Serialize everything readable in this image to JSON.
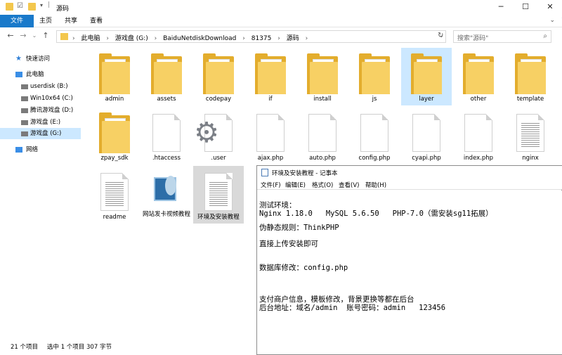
{
  "explorer": {
    "title": "源码",
    "ribbon_tabs": [
      "文件",
      "主页",
      "共享",
      "查看"
    ],
    "breadcrumb": [
      "此电脑",
      "游戏盘 (G:)",
      "BaiduNetdiskDownload",
      "81375",
      "源码"
    ],
    "search_placeholder": "搜索\"源码\"",
    "nav": {
      "quick_access": "快速访问",
      "this_pc": "此电脑",
      "drives": [
        "userdisk (B:)",
        "Win10x64 (C:)",
        "腾讯游戏盘 (D:)",
        "游戏盘 (E:)",
        "游戏盘 (G:)"
      ],
      "network": "网络"
    },
    "items": [
      {
        "name": "admin",
        "type": "folder"
      },
      {
        "name": "assets",
        "type": "folder"
      },
      {
        "name": "codepay",
        "type": "folder"
      },
      {
        "name": "if",
        "type": "folder"
      },
      {
        "name": "install",
        "type": "folder"
      },
      {
        "name": "js",
        "type": "folder"
      },
      {
        "name": "layer",
        "type": "folder"
      },
      {
        "name": "other",
        "type": "folder"
      },
      {
        "name": "template",
        "type": "folder"
      },
      {
        "name": "zpay_sdk",
        "type": "folder"
      },
      {
        "name": ".htaccess",
        "type": "file"
      },
      {
        "name": ".user",
        "type": "settings"
      },
      {
        "name": "ajax.php",
        "type": "file"
      },
      {
        "name": "auto.php",
        "type": "file"
      },
      {
        "name": "config.php",
        "type": "file"
      },
      {
        "name": "cyapi.php",
        "type": "file"
      },
      {
        "name": "index.php",
        "type": "file"
      },
      {
        "name": "nginx",
        "type": "text"
      },
      {
        "name": "readme",
        "type": "text"
      },
      {
        "name": "网站发卡视频教程",
        "type": "video"
      },
      {
        "name": "环境及安装教程",
        "type": "text"
      }
    ],
    "status": {
      "count": "21 个项目",
      "selection": "选中 1 个项目  307 字节"
    }
  },
  "notepad": {
    "title": "环境及安装教程 - 记事本",
    "menu": [
      "文件(F)",
      "编辑(E)",
      "格式(O)",
      "查看(V)",
      "帮助(H)"
    ],
    "lines": [
      "测试环境：",
      "Nginx 1.18.0   MySQL 5.6.50   PHP-7.0（需安装sg11拓展）",
      "",
      "伪静态规则：ThinkPHP",
      "",
      "直接上传安装即可",
      "",
      "",
      "数据库修改：config.php",
      "",
      "",
      "",
      "支付商户信息，模板修改，背景更换等都在后台",
      "后台地址：域名/admin  账号密码：admin   123456"
    ]
  }
}
